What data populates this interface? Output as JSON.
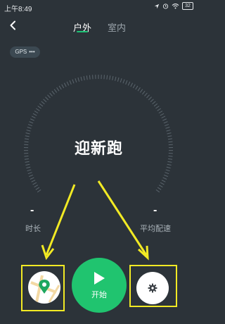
{
  "status_bar": {
    "time": "上午8:49",
    "battery": "32"
  },
  "tabs": [
    {
      "label": "户外",
      "active": true
    },
    {
      "label": "室内",
      "active": false
    }
  ],
  "gps_badge": {
    "label": "GPS",
    "dots": "•••"
  },
  "mode_title": "迎新跑",
  "stats": {
    "duration": {
      "value": "-",
      "label": "时长"
    },
    "pace": {
      "value": "-",
      "label": "平均配速"
    }
  },
  "actions": {
    "start_label": "开始"
  },
  "colors": {
    "background": "#2c3339",
    "accent": "#1ec275",
    "start_button": "#20c46f",
    "highlight": "#f2ea24",
    "muted_text": "#9aa3aa"
  },
  "icons": {
    "back": "chevron-left-icon",
    "location": "location-arrow-icon",
    "wifi": "wifi-icon",
    "map": "map-icon",
    "settings": "gear-icon",
    "play": "play-icon"
  }
}
